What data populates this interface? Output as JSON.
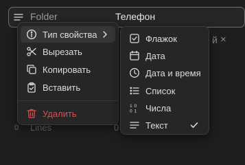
{
  "property": {
    "name": "Folder",
    "value": "Телефон"
  },
  "background": {
    "fragment_right": "й",
    "fragment_close": "×",
    "fragment_left": "0",
    "fragment_lines": "Lines",
    "fragment_zero": "0"
  },
  "context_menu": {
    "items": [
      {
        "label": "Тип свойства",
        "icon": "info-icon"
      },
      {
        "label": "Вырезать",
        "icon": "scissors-icon"
      },
      {
        "label": "Копировать",
        "icon": "copy-icon"
      },
      {
        "label": "Вставить",
        "icon": "clipboard-icon"
      },
      {
        "label": "Удалить",
        "icon": "trash-icon"
      }
    ]
  },
  "type_submenu": {
    "items": [
      {
        "label": "Флажок",
        "icon": "checkbox-icon"
      },
      {
        "label": "Дата",
        "icon": "calendar-icon"
      },
      {
        "label": "Дата и время",
        "icon": "clock-icon"
      },
      {
        "label": "Список",
        "icon": "list-icon"
      },
      {
        "label": "Числа",
        "icon": "numbers-icon"
      },
      {
        "label": "Текст",
        "icon": "text-icon",
        "selected": true
      }
    ]
  },
  "colors": {
    "background": "#1e1e1e",
    "menu": "#262626",
    "danger": "#e8474c",
    "text": "#dcddde"
  }
}
